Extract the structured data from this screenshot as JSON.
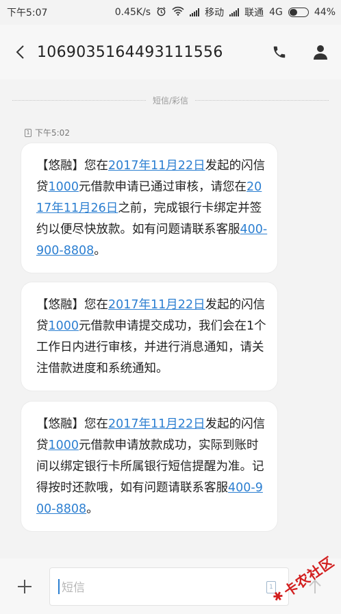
{
  "status_bar": {
    "time": "下午5:07",
    "speed": "0.45K/s",
    "carrier1": "移动",
    "carrier2": "联通",
    "network": "4G",
    "battery": "44%",
    "battery_level": 0.44
  },
  "header": {
    "title": "1069035164493111556",
    "icons": [
      "back-icon",
      "phone-icon",
      "contact-icon"
    ]
  },
  "divider_label": "短信/彩信",
  "message_time": "下午5:02",
  "sim_label": "1",
  "messages": [
    {
      "p1": "【悠融】您在",
      "date": "2017年11月22日",
      "p2": "发起的闪信贷",
      "amount": "1000",
      "p3": "元借款申请已通过审核，请您在",
      "deadline": "2017年11月26日",
      "p4": "之前，完成银行卡绑定并签约以便尽快放款。如有问题请联系客服",
      "phone": "400-900-8808",
      "p5": "。"
    },
    {
      "p1": "【悠融】您在",
      "date": "2017年11月22日",
      "p2": "发起的闪信贷",
      "amount": "1000",
      "p3": "元借款申请提交成功，我们会在1个工作日内进行审核，并进行消息通知，请关注借款进度和系统通知。"
    },
    {
      "p1": "【悠融】您在",
      "date": "2017年11月22日",
      "p2": "发起的闪信贷",
      "amount": "1000",
      "p3": "元借款申请放款成功，实际到账时间以绑定银行卡所属银行短信提醒为准。记得按时还款哦，如有问题请联系客服",
      "phone": "400-900-8808",
      "p4": "。"
    }
  ],
  "input": {
    "placeholder": "短信",
    "sim_label": "1"
  },
  "watermark": "卡农社区",
  "colors": {
    "link": "#2c7fd1",
    "background": "#f3f3f3",
    "bubble": "#ffffff",
    "watermark": "#d21e1e"
  }
}
